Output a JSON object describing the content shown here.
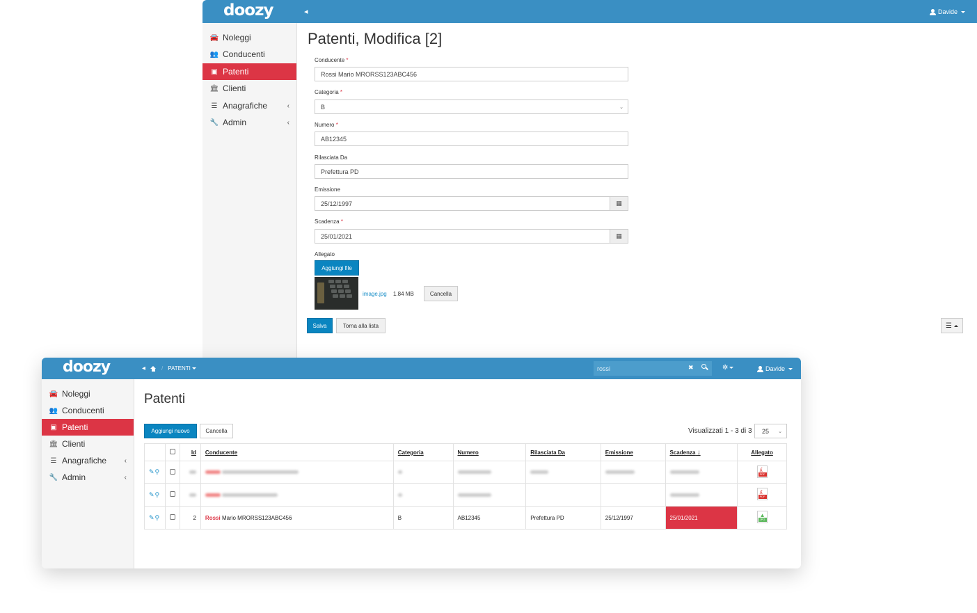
{
  "back": {
    "logo": "doozy",
    "user": "Davide",
    "sidebar": [
      {
        "label": "Noleggi",
        "icon": "car-icon"
      },
      {
        "label": "Conducenti",
        "icon": "users-icon"
      },
      {
        "label": "Patenti",
        "icon": "id-card-icon",
        "active": true
      },
      {
        "label": "Clienti",
        "icon": "bank-icon"
      },
      {
        "label": "Anagrafiche",
        "icon": "list-icon",
        "submenu": true
      },
      {
        "label": "Admin",
        "icon": "wrench-icon",
        "submenu": true
      }
    ],
    "title": "Patenti, Modifica [2]",
    "form": {
      "conducente_label": "Conducente",
      "conducente_value": "Rossi Mario MRORSS123ABC456",
      "categoria_label": "Categoria",
      "categoria_value": "B",
      "numero_label": "Numero",
      "numero_value": "AB12345",
      "rilasciata_label": "Rilasciata Da",
      "rilasciata_value": "Prefettura PD",
      "emissione_label": "Emissione",
      "emissione_value": "25/12/1997",
      "scadenza_label": "Scadenza",
      "scadenza_value": "25/01/2021",
      "required_mark": "*",
      "allegato_label": "Allegato",
      "add_file_label": "Aggiungi file",
      "file_name": "image.jpg",
      "file_size": "1.84 MB",
      "file_delete_label": "Cancella",
      "save_label": "Salva",
      "back_label": "Torna alla lista"
    }
  },
  "front": {
    "logo": "doozy",
    "breadcrumb": "PATENTI",
    "search_value": "rossi",
    "user": "Davide",
    "sidebar": [
      {
        "label": "Noleggi",
        "icon": "car-icon"
      },
      {
        "label": "Conducenti",
        "icon": "users-icon"
      },
      {
        "label": "Patenti",
        "icon": "id-card-icon",
        "active": true
      },
      {
        "label": "Clienti",
        "icon": "bank-icon"
      },
      {
        "label": "Anagrafiche",
        "icon": "list-icon",
        "submenu": true
      },
      {
        "label": "Admin",
        "icon": "wrench-icon",
        "submenu": true
      }
    ],
    "title": "Patenti",
    "add_label": "Aggiungi nuovo",
    "delete_label": "Cancella",
    "paging": "Visualizzati 1 - 3 di 3",
    "page_size": "25",
    "columns": {
      "id": "Id",
      "conducente": "Conducente",
      "categoria": "Categoria",
      "numero": "Numero",
      "rilasciata": "Rilasciata Da",
      "emissione": "Emissione",
      "scadenza": "Scadenza",
      "allegato": "Allegato"
    },
    "rows": [
      {
        "blurred": true,
        "allegato": "PDF"
      },
      {
        "blurred": true,
        "allegato": "PDF"
      },
      {
        "id": "2",
        "cond_highlight": "Rossi",
        "cond_rest": " Mario MRORSS123ABC456",
        "categoria": "B",
        "numero": "AB12345",
        "rilasciata": "Prefettura PD",
        "emissione": "25/12/1997",
        "scadenza": "25/01/2021",
        "scadenza_expired": true,
        "allegato": "JPG"
      }
    ],
    "colors": {
      "topbar": "#3a8fc3",
      "active": "#dc3545",
      "primary": "#0a85c0"
    }
  }
}
